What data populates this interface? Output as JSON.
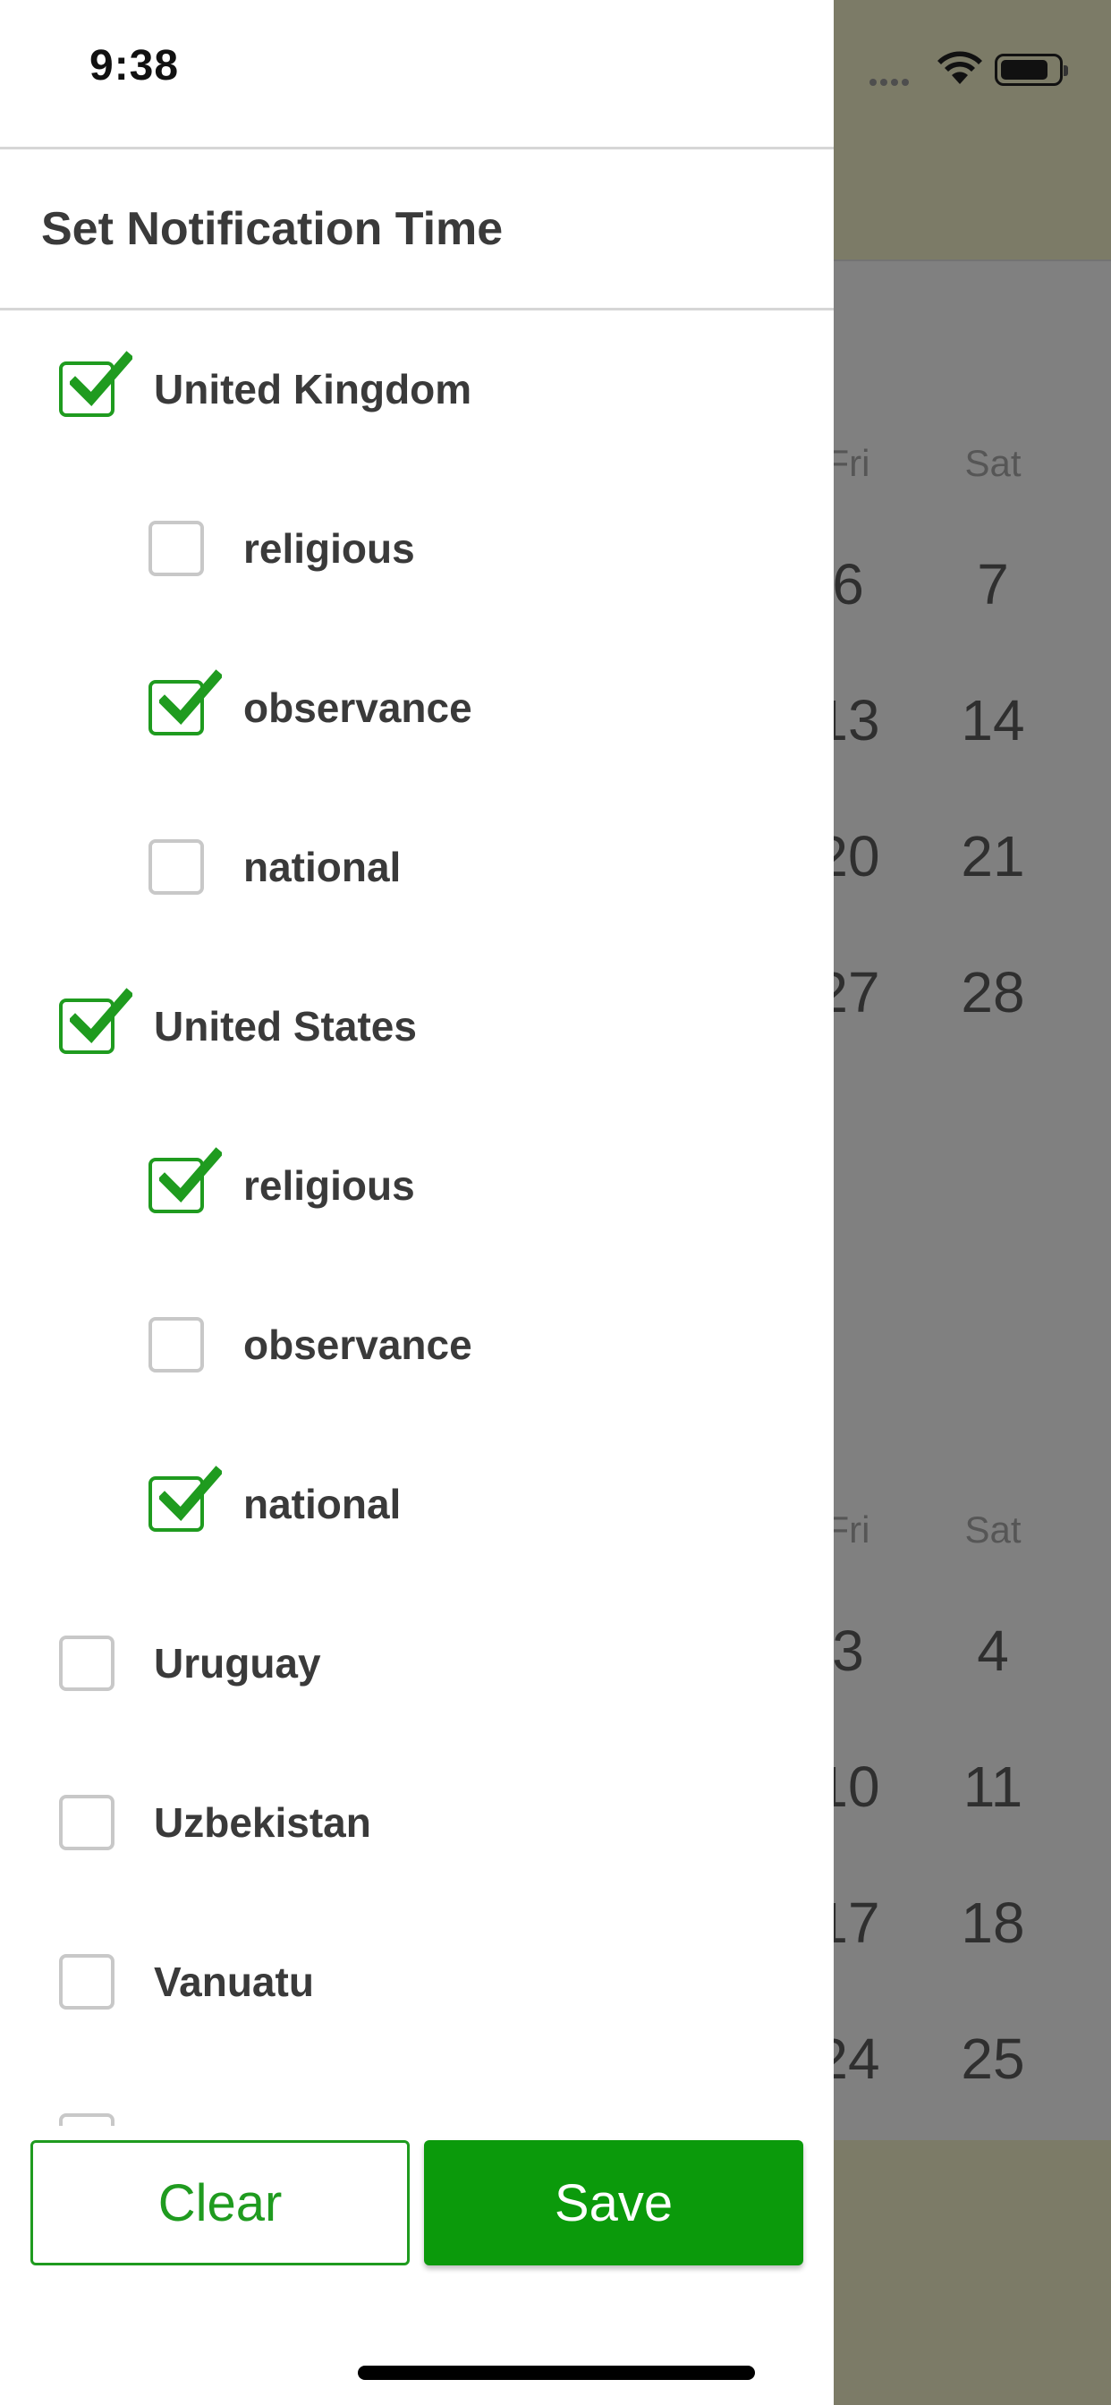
{
  "status_bar": {
    "time": "9:38"
  },
  "drawer": {
    "title": "Set Notification Time",
    "items": [
      {
        "label": "United Kingdom",
        "level": 0,
        "checked": true
      },
      {
        "label": "religious",
        "level": 1,
        "checked": false
      },
      {
        "label": "observance",
        "level": 1,
        "checked": true
      },
      {
        "label": "national",
        "level": 1,
        "checked": false
      },
      {
        "label": "United States",
        "level": 0,
        "checked": true
      },
      {
        "label": "religious",
        "level": 1,
        "checked": true
      },
      {
        "label": "observance",
        "level": 1,
        "checked": false
      },
      {
        "label": "national",
        "level": 1,
        "checked": true
      },
      {
        "label": "Uruguay",
        "level": 0,
        "checked": false
      },
      {
        "label": "Uzbekistan",
        "level": 0,
        "checked": false
      },
      {
        "label": "Vanuatu",
        "level": 0,
        "checked": false
      }
    ],
    "buttons": {
      "clear": "Clear",
      "save": "Save"
    }
  },
  "background_calendar": {
    "top": {
      "days": [
        "Fri",
        "Sat"
      ],
      "rows": [
        [
          "6",
          "7"
        ],
        [
          "13",
          "14"
        ],
        [
          "20",
          "21"
        ],
        [
          "27",
          "28"
        ]
      ]
    },
    "bottom": {
      "days": [
        "Fri",
        "Sat"
      ],
      "rows": [
        [
          "3",
          "4"
        ],
        [
          "10",
          "11"
        ],
        [
          "17",
          "18"
        ],
        [
          "24",
          "25"
        ]
      ]
    }
  },
  "colors": {
    "accent": "#0b9a0b",
    "text": "#3a3a3a",
    "checkbox_border": "#c8c8c8"
  }
}
